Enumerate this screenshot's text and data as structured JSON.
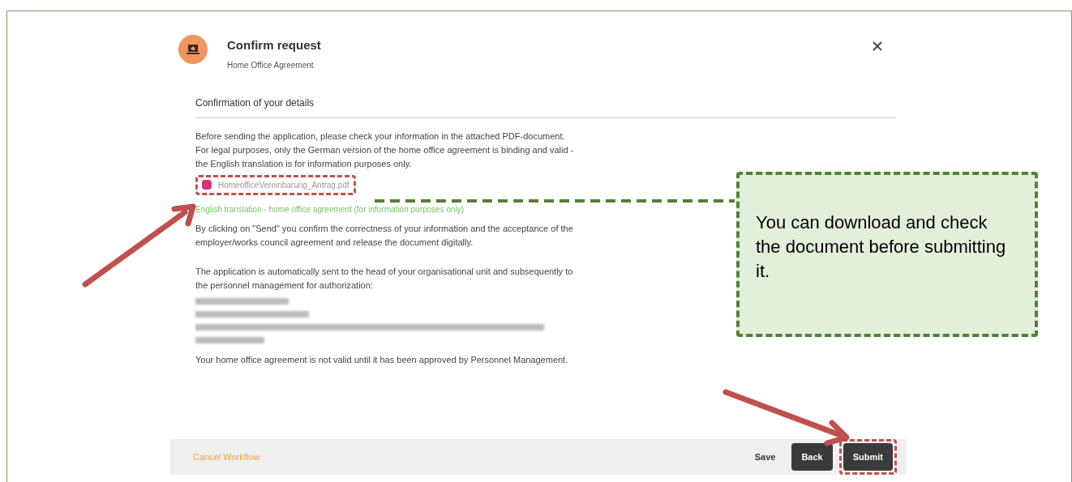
{
  "header": {
    "title": "Confirm request",
    "subtitle": "Home Office Agreement"
  },
  "section_title": "Confirmation of your details",
  "intro": [
    "Before sending the application, please check your information in the attached PDF-document.",
    "For legal purposes, only the German version of the home office agreement is binding and valid - the English translation is for information purposes only."
  ],
  "attachment": {
    "file_name": "HomeofficeVereinbarung_Antrag.pdf"
  },
  "translation_link": "English translation - home office agreement (for information purposes only)",
  "confirmation_text": "By clicking on \"Send\" you confirm the correctness of your information and the acceptance of the employer/works council agreement and release the document digitally.",
  "routing_text": "The application is automatically sent to the head of your organisational unit and subsequently to the personnel management for authorization:",
  "notice": "Your home office agreement is not valid until it has been approved by Personnel Management.",
  "footer": {
    "cancel": "Cancel Workflow",
    "buttons": [
      {
        "label": "Save",
        "kind": "text",
        "highlighted": false
      },
      {
        "label": "Back",
        "kind": "dark",
        "highlighted": false
      },
      {
        "label": "Submit",
        "kind": "dark",
        "highlighted": true
      }
    ]
  },
  "callout": "You can download and check the document before submitting it."
}
